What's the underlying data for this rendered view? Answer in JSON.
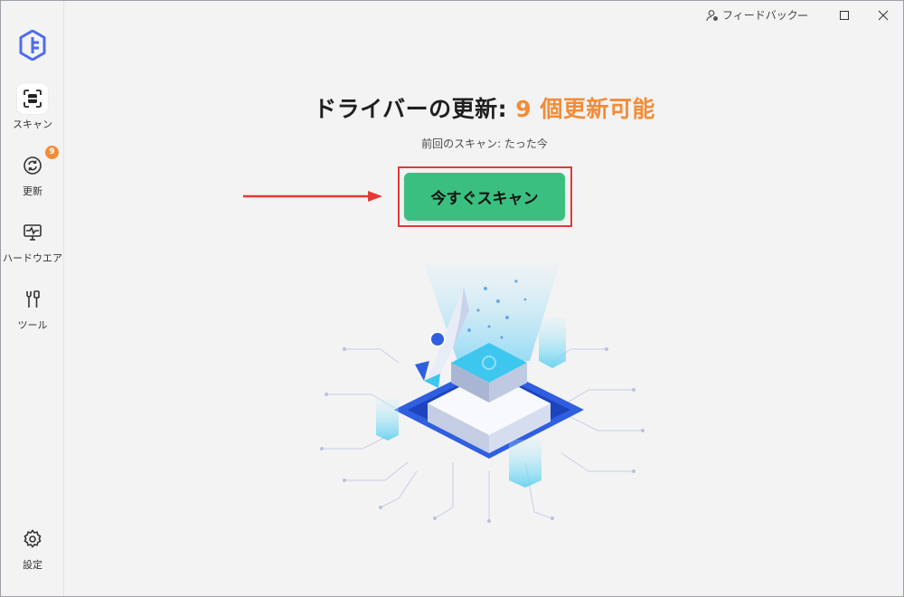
{
  "sidebar": {
    "logo_icon": "brand-logo",
    "items": [
      {
        "label": "スキャン",
        "icon": "scan-icon",
        "active": true
      },
      {
        "label": "更新",
        "icon": "refresh-icon",
        "badge": "9"
      },
      {
        "label": "ハードウエア",
        "icon": "monitor-icon"
      },
      {
        "label": "ツール",
        "icon": "tools-icon"
      }
    ],
    "settings_label": "設定"
  },
  "titlebar": {
    "feedback_label": "フィードバック",
    "controls": [
      "minimize",
      "maximize",
      "close"
    ]
  },
  "main": {
    "title_prefix": "ドライバーの更新: ",
    "title_accent": "9 個更新可能",
    "last_scan": "前回のスキャン: たった今",
    "scan_button": "今すぐスキャン"
  },
  "colors": {
    "accent": "#f28c38",
    "primary_button": "#3bbf80",
    "highlight_box": "#e53935"
  }
}
